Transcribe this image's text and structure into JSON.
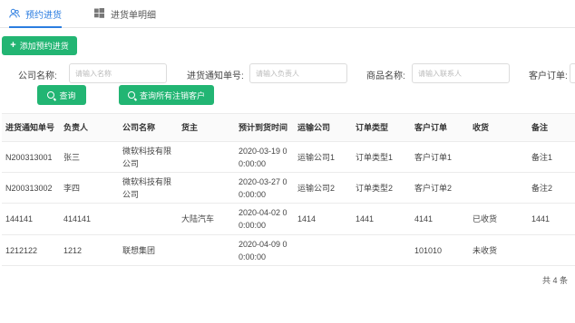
{
  "tabs": [
    {
      "label": "预约进货",
      "icon": "users-icon",
      "active": true
    },
    {
      "label": "进货单明细",
      "icon": "windows-icon",
      "active": false
    }
  ],
  "toolbar": {
    "add_label": "添加预约进货"
  },
  "filters": {
    "company": {
      "label": "公司名称:",
      "placeholder": "请输入名称"
    },
    "notice_no": {
      "label": "进货通知单号:",
      "placeholder": "请输入负责人"
    },
    "product": {
      "label": "商品名称:",
      "placeholder": "请输入联系人"
    },
    "customer_order": {
      "label": "客户订单:",
      "placeholder": ""
    },
    "search_label": "查询",
    "search_all_label": "查询所有注销客户"
  },
  "table": {
    "columns": [
      "进货通知单号",
      "负责人",
      "公司名称",
      "货主",
      "预计到货时间",
      "运输公司",
      "订单类型",
      "客户订单",
      "收货",
      "备注"
    ],
    "rows": [
      {
        "notice_no": "N200313001",
        "owner": "张三",
        "company": "微软科技有限公司",
        "cargo_owner": "",
        "eta": "2020-03-19 00:00:00",
        "carrier": "运输公司1",
        "order_type": "订单类型1",
        "customer_order": "客户订单1",
        "received": "",
        "note": "备注1"
      },
      {
        "notice_no": "N200313002",
        "owner": "李四",
        "company": "微软科技有限公司",
        "cargo_owner": "",
        "eta": "2020-03-27 00:00:00",
        "carrier": "运输公司2",
        "order_type": "订单类型2",
        "customer_order": "客户订单2",
        "received": "",
        "note": "备注2"
      },
      {
        "notice_no": "144141",
        "owner": "414141",
        "company": "",
        "cargo_owner": "大陆汽车",
        "eta": "2020-04-02 00:00:00",
        "carrier": "1414",
        "order_type": "1441",
        "customer_order": "4141",
        "received": "已收货",
        "note": "1441"
      },
      {
        "notice_no": "1212122",
        "owner": "1212",
        "company": "联想集团",
        "cargo_owner": "",
        "eta": "2020-04-09 00:00:00",
        "carrier": "",
        "order_type": "",
        "customer_order": "101010",
        "received": "未收货",
        "note": ""
      }
    ]
  },
  "pagination": {
    "total_text": "共 4 条"
  },
  "colors": {
    "accent": "#22b573",
    "tab_active": "#2b7de0"
  }
}
